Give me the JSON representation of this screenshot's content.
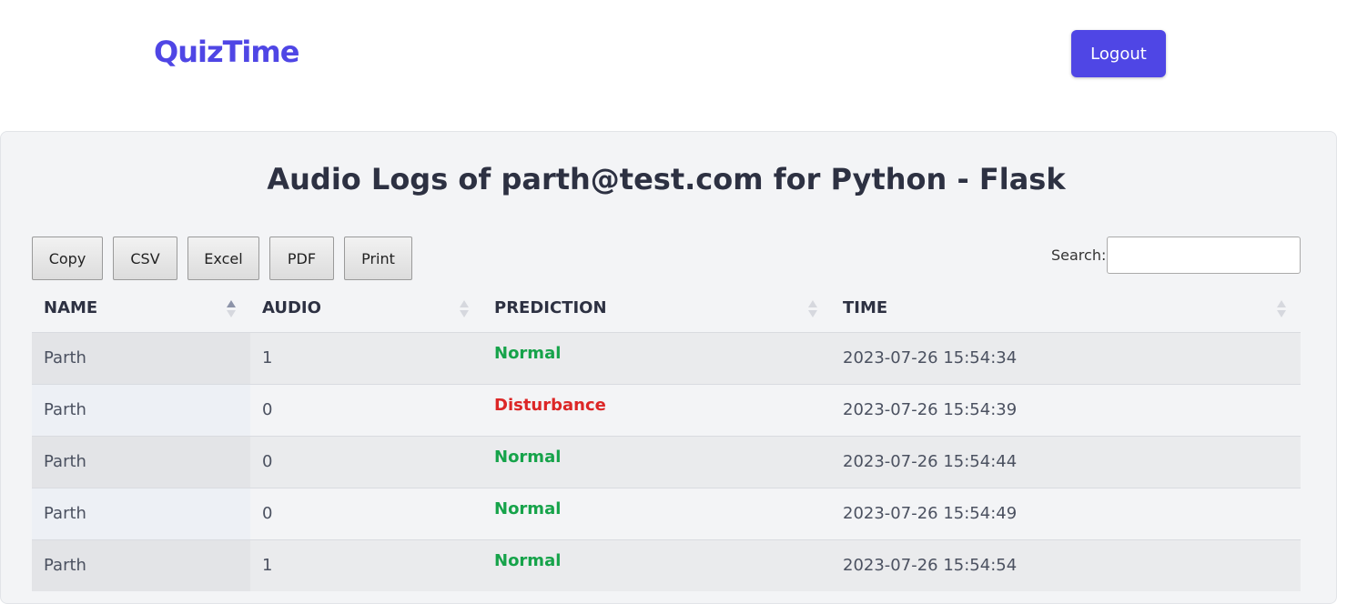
{
  "navbar": {
    "brand": "QuizTime",
    "logout_label": "Logout"
  },
  "page": {
    "title": "Audio Logs of parth@test.com for Python - Flask"
  },
  "toolbar": {
    "buttons": [
      "Copy",
      "CSV",
      "Excel",
      "PDF",
      "Print"
    ],
    "search_label": "Search:",
    "search_value": ""
  },
  "table": {
    "columns": [
      "NAME",
      "AUDIO",
      "PREDICTION",
      "TIME"
    ],
    "sorted_column": "NAME",
    "sort_direction": "ascending",
    "rows": [
      {
        "name": "Parth",
        "audio": "1",
        "prediction": "Normal",
        "time": "2023-07-26 15:54:34"
      },
      {
        "name": "Parth",
        "audio": "0",
        "prediction": "Disturbance",
        "time": "2023-07-26 15:54:39"
      },
      {
        "name": "Parth",
        "audio": "0",
        "prediction": "Normal",
        "time": "2023-07-26 15:54:44"
      },
      {
        "name": "Parth",
        "audio": "0",
        "prediction": "Normal",
        "time": "2023-07-26 15:54:49"
      },
      {
        "name": "Parth",
        "audio": "1",
        "prediction": "Normal",
        "time": "2023-07-26 15:54:54"
      }
    ]
  },
  "colors": {
    "brand": "#4f46e5",
    "normal": "#16a34a",
    "disturbance": "#dc2626",
    "card_bg": "#f3f4f6"
  }
}
